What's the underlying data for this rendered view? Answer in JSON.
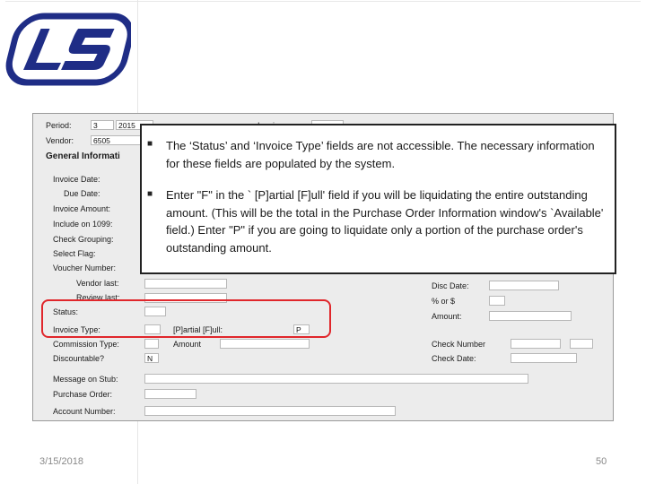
{
  "form": {
    "period_label": "Period:",
    "period_value": "3",
    "year_value": "2015",
    "invoice_label": "Invoice:",
    "vendor_label": "Vendor:",
    "vendor_value": "6505",
    "general_info": "General Informati",
    "invoice_date": "Invoice Date:",
    "due_date": "Due Date:",
    "invoice_amount": "Invoice Amount:",
    "include_1099": "Include on 1099:",
    "check_grouping": "Check Grouping:",
    "select_flag": "Select Flag:",
    "voucher_number": "Voucher Number:",
    "vendor_last": "Vendor last:",
    "review_last": "Review last:",
    "status": "Status:",
    "invoice_type": "Invoice Type:",
    "partial_full": "[P]artial [F]ull:",
    "partial_full_value": "P",
    "commission_type": "Commission Type:",
    "amount": "Amount",
    "discountable": "Discountable?",
    "discountable_value": "N",
    "message_on_stub": "Message on Stub:",
    "purchase_order": "Purchase Order:",
    "account_number": "Account Number:",
    "disc_date": "Disc Date:",
    "pct_or_s": "% or $",
    "amount_right": "Amount:",
    "check_number": "Check Number",
    "check_date": "Check Date:"
  },
  "callout": {
    "bullet1": "The ‘Status’ and ‘Invoice Type’ fields are not accessible.  The necessary information for these fields are populated by the system.",
    "bullet2": "Enter \"F\" in the ` [P]artial [F]ull' field if you will be liquidating the entire outstanding amount.  (This will be the total in the Purchase Order Information window's `Available' field.)  Enter \"P\" if you are going to liquidate only a portion of the purchase order's outstanding amount."
  },
  "footer": {
    "date": "3/15/2018",
    "page": "50"
  },
  "colors": {
    "logo_blue": "#1f2d86",
    "highlight_red": "#e0262b"
  }
}
